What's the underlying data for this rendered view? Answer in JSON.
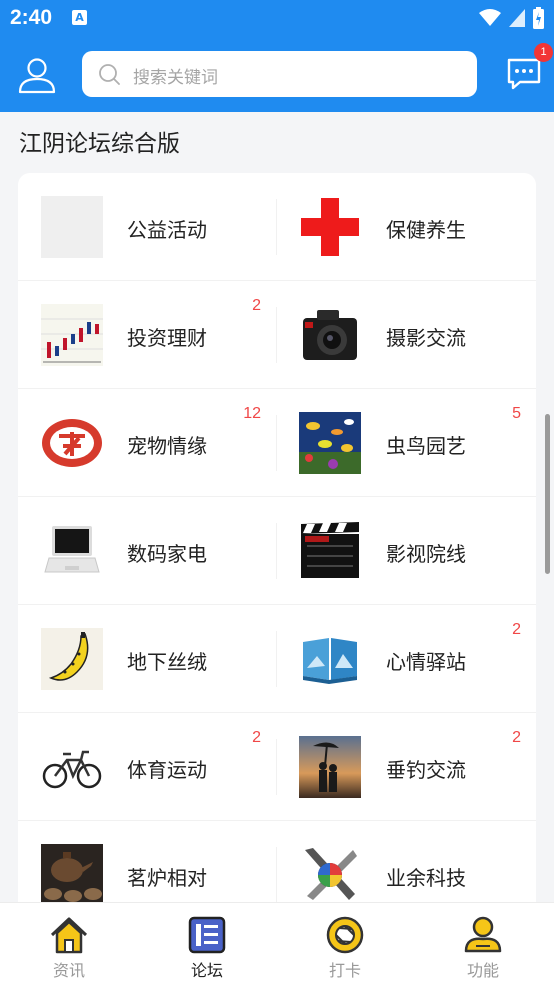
{
  "status_bar": {
    "time": "2:40",
    "notif_glyph": "A"
  },
  "header": {
    "search_placeholder": "搜索关键词",
    "message_badge": "1"
  },
  "section": {
    "title": "江阴论坛综合版"
  },
  "forums": [
    {
      "left": {
        "name": "公益活动",
        "count": "",
        "icon": "blank-thumbnail"
      },
      "right": {
        "name": "保健养生",
        "count": "",
        "icon": "red-cross"
      }
    },
    {
      "left": {
        "name": "投资理财",
        "count": "2",
        "icon": "stock-chart"
      },
      "right": {
        "name": "摄影交流",
        "count": "",
        "icon": "camera"
      }
    },
    {
      "left": {
        "name": "宠物情缘",
        "count": "12",
        "icon": "pet-logo"
      },
      "right": {
        "name": "虫鸟园艺",
        "count": "5",
        "icon": "aquarium-fish"
      }
    },
    {
      "left": {
        "name": "数码家电",
        "count": "",
        "icon": "laptop"
      },
      "right": {
        "name": "影视院线",
        "count": "",
        "icon": "film-clapperboard"
      }
    },
    {
      "left": {
        "name": "地下丝绒",
        "count": "",
        "icon": "banana"
      },
      "right": {
        "name": "心情驿站",
        "count": "2",
        "icon": "photo-album"
      }
    },
    {
      "left": {
        "name": "体育运动",
        "count": "2",
        "icon": "bicycle"
      },
      "right": {
        "name": "垂钓交流",
        "count": "2",
        "icon": "sunset-couple"
      }
    },
    {
      "left": {
        "name": "茗炉相对",
        "count": "",
        "icon": "teapot"
      },
      "right": {
        "name": "业余科技",
        "count": "",
        "icon": "tools"
      }
    }
  ],
  "bottom_nav": [
    {
      "label": "资讯",
      "icon": "home-icon",
      "active": false
    },
    {
      "label": "论坛",
      "icon": "forum-list-icon",
      "active": true
    },
    {
      "label": "打卡",
      "icon": "camera-aperture-icon",
      "active": false
    },
    {
      "label": "功能",
      "icon": "person-icon",
      "active": false
    }
  ],
  "colors": {
    "primary": "#1f8bf0",
    "badge": "#f23535",
    "count": "#f04747",
    "nav_accent": "#f5c518"
  }
}
